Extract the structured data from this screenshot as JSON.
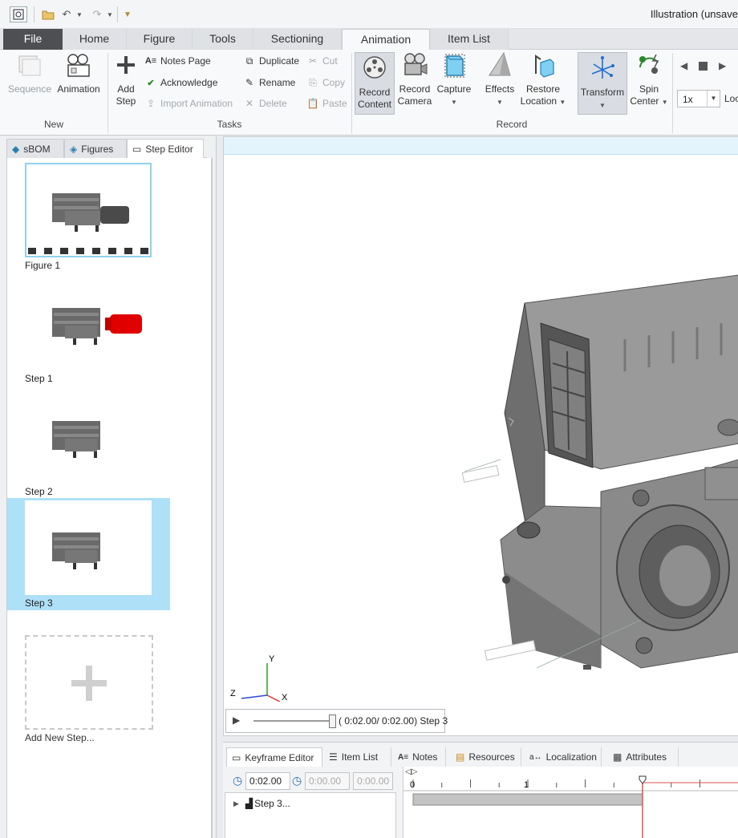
{
  "window": {
    "title": "Illustration (unsave"
  },
  "ribbon": {
    "tabs": [
      "File",
      "Home",
      "Figure",
      "Tools",
      "Sectioning",
      "Animation",
      "Item List"
    ],
    "active_tab": "Animation",
    "groups": {
      "new": {
        "label": "New",
        "sequence": "Sequence",
        "animation": "Animation"
      },
      "tasks": {
        "label": "Tasks",
        "add_step_1": "Add",
        "add_step_2": "Step",
        "notes_page": "Notes Page",
        "acknowledge": "Acknowledge",
        "import_animation": "Import Animation",
        "duplicate": "Duplicate",
        "rename": "Rename",
        "delete": "Delete",
        "cut": "Cut",
        "copy": "Copy",
        "paste": "Paste"
      },
      "record": {
        "label": "Record",
        "record_content_1": "Record",
        "record_content_2": "Content",
        "record_camera_1": "Record",
        "record_camera_2": "Camera",
        "capture": "Capture",
        "effects": "Effects",
        "restore_location_1": "Restore",
        "restore_location_2": "Location",
        "transform": "Transform",
        "spin_center_1": "Spin",
        "spin_center_2": "Center"
      },
      "playback": {
        "speed_value": "1x",
        "loop_label": "Loo"
      }
    }
  },
  "left_panel": {
    "tabs": [
      "sBOM",
      "Figures",
      "Step Editor"
    ],
    "active_tab": "Step Editor",
    "steps": [
      {
        "label": "Figure 1"
      },
      {
        "label": "Step 1"
      },
      {
        "label": "Step 2"
      },
      {
        "label": "Step 3",
        "selected": true
      }
    ],
    "add_step_label": "Add New Step..."
  },
  "viewport": {
    "axes": {
      "x": "X",
      "y": "Y",
      "z": "Z"
    },
    "playback": {
      "time_readout": "( 0:02.00/ 0:02.00)",
      "step_name": "Step 3",
      "slider_position": 1.0
    }
  },
  "bottom_panel": {
    "tabs": [
      "Keyframe Editor",
      "Item List",
      "Notes",
      "Resources",
      "Localization",
      "Attributes"
    ],
    "active_tab": "Keyframe Editor",
    "time_fields": {
      "current": "0:02.00",
      "start": "0:00.00",
      "end": "0:00.00"
    },
    "tree": [
      {
        "label": "Step 3..."
      }
    ],
    "timeline": {
      "tick_labels": [
        "0",
        "1"
      ],
      "playhead_time": 2.0
    }
  },
  "colors": {
    "accent_blue": "#aee0f7",
    "selection_border": "#8fd1ee",
    "file_tab": "#4d4f53",
    "playhead": "#d9534f"
  }
}
